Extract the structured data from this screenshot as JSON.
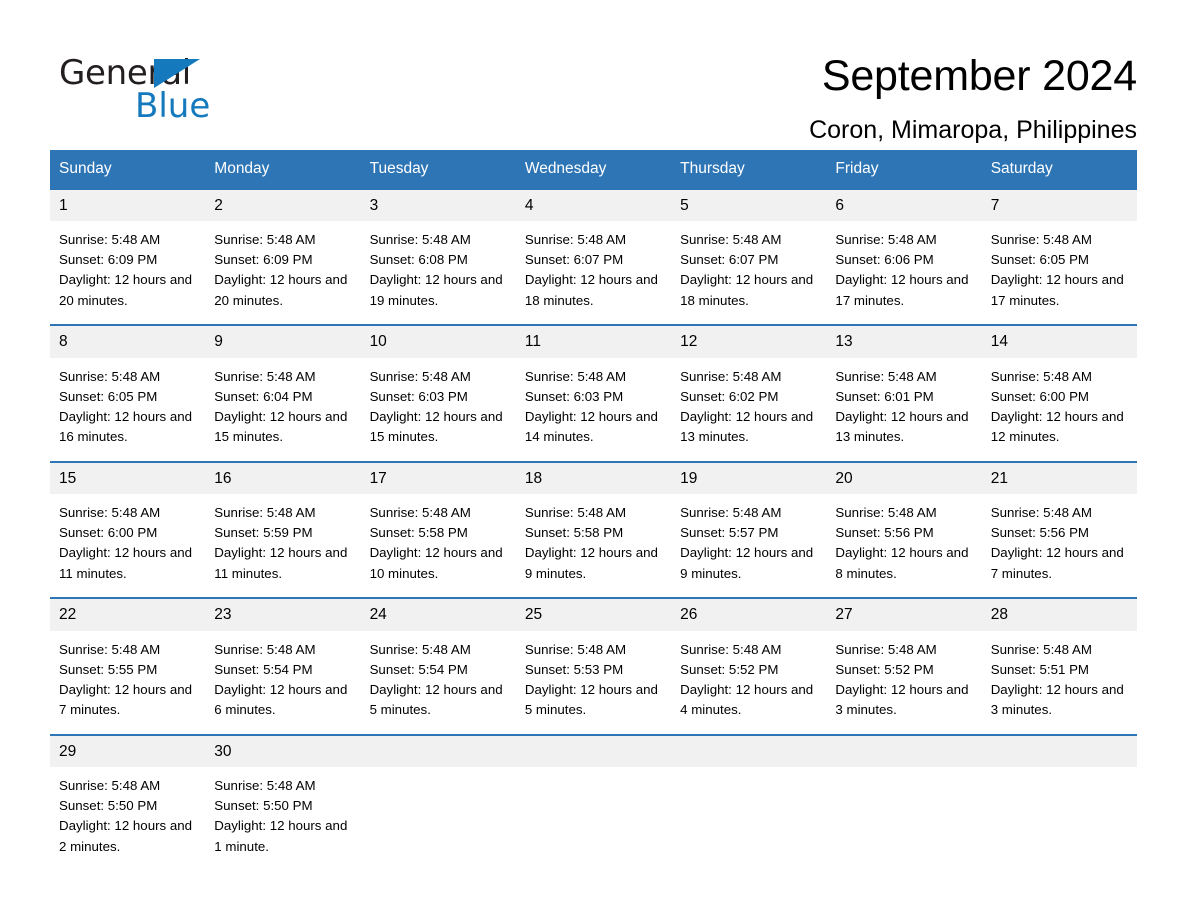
{
  "brand": {
    "name_part1": "General",
    "name_part2": "Blue",
    "accent_color": "#1479bd"
  },
  "header": {
    "title": "September 2024",
    "subtitle": "Coron, Mimaropa, Philippines"
  },
  "calendar": {
    "header_color": "#2E75B6",
    "daynum_band_color": "#F1F1F1",
    "weekdays": [
      "Sunday",
      "Monday",
      "Tuesday",
      "Wednesday",
      "Thursday",
      "Friday",
      "Saturday"
    ],
    "weeks": [
      {
        "days": [
          {
            "num": "1",
            "sunrise": "Sunrise: 5:48 AM",
            "sunset": "Sunset: 6:09 PM",
            "daylight": "Daylight: 12 hours and 20 minutes."
          },
          {
            "num": "2",
            "sunrise": "Sunrise: 5:48 AM",
            "sunset": "Sunset: 6:09 PM",
            "daylight": "Daylight: 12 hours and 20 minutes."
          },
          {
            "num": "3",
            "sunrise": "Sunrise: 5:48 AM",
            "sunset": "Sunset: 6:08 PM",
            "daylight": "Daylight: 12 hours and 19 minutes."
          },
          {
            "num": "4",
            "sunrise": "Sunrise: 5:48 AM",
            "sunset": "Sunset: 6:07 PM",
            "daylight": "Daylight: 12 hours and 18 minutes."
          },
          {
            "num": "5",
            "sunrise": "Sunrise: 5:48 AM",
            "sunset": "Sunset: 6:07 PM",
            "daylight": "Daylight: 12 hours and 18 minutes."
          },
          {
            "num": "6",
            "sunrise": "Sunrise: 5:48 AM",
            "sunset": "Sunset: 6:06 PM",
            "daylight": "Daylight: 12 hours and 17 minutes."
          },
          {
            "num": "7",
            "sunrise": "Sunrise: 5:48 AM",
            "sunset": "Sunset: 6:05 PM",
            "daylight": "Daylight: 12 hours and 17 minutes."
          }
        ]
      },
      {
        "days": [
          {
            "num": "8",
            "sunrise": "Sunrise: 5:48 AM",
            "sunset": "Sunset: 6:05 PM",
            "daylight": "Daylight: 12 hours and 16 minutes."
          },
          {
            "num": "9",
            "sunrise": "Sunrise: 5:48 AM",
            "sunset": "Sunset: 6:04 PM",
            "daylight": "Daylight: 12 hours and 15 minutes."
          },
          {
            "num": "10",
            "sunrise": "Sunrise: 5:48 AM",
            "sunset": "Sunset: 6:03 PM",
            "daylight": "Daylight: 12 hours and 15 minutes."
          },
          {
            "num": "11",
            "sunrise": "Sunrise: 5:48 AM",
            "sunset": "Sunset: 6:03 PM",
            "daylight": "Daylight: 12 hours and 14 minutes."
          },
          {
            "num": "12",
            "sunrise": "Sunrise: 5:48 AM",
            "sunset": "Sunset: 6:02 PM",
            "daylight": "Daylight: 12 hours and 13 minutes."
          },
          {
            "num": "13",
            "sunrise": "Sunrise: 5:48 AM",
            "sunset": "Sunset: 6:01 PM",
            "daylight": "Daylight: 12 hours and 13 minutes."
          },
          {
            "num": "14",
            "sunrise": "Sunrise: 5:48 AM",
            "sunset": "Sunset: 6:00 PM",
            "daylight": "Daylight: 12 hours and 12 minutes."
          }
        ]
      },
      {
        "days": [
          {
            "num": "15",
            "sunrise": "Sunrise: 5:48 AM",
            "sunset": "Sunset: 6:00 PM",
            "daylight": "Daylight: 12 hours and 11 minutes."
          },
          {
            "num": "16",
            "sunrise": "Sunrise: 5:48 AM",
            "sunset": "Sunset: 5:59 PM",
            "daylight": "Daylight: 12 hours and 11 minutes."
          },
          {
            "num": "17",
            "sunrise": "Sunrise: 5:48 AM",
            "sunset": "Sunset: 5:58 PM",
            "daylight": "Daylight: 12 hours and 10 minutes."
          },
          {
            "num": "18",
            "sunrise": "Sunrise: 5:48 AM",
            "sunset": "Sunset: 5:58 PM",
            "daylight": "Daylight: 12 hours and 9 minutes."
          },
          {
            "num": "19",
            "sunrise": "Sunrise: 5:48 AM",
            "sunset": "Sunset: 5:57 PM",
            "daylight": "Daylight: 12 hours and 9 minutes."
          },
          {
            "num": "20",
            "sunrise": "Sunrise: 5:48 AM",
            "sunset": "Sunset: 5:56 PM",
            "daylight": "Daylight: 12 hours and 8 minutes."
          },
          {
            "num": "21",
            "sunrise": "Sunrise: 5:48 AM",
            "sunset": "Sunset: 5:56 PM",
            "daylight": "Daylight: 12 hours and 7 minutes."
          }
        ]
      },
      {
        "days": [
          {
            "num": "22",
            "sunrise": "Sunrise: 5:48 AM",
            "sunset": "Sunset: 5:55 PM",
            "daylight": "Daylight: 12 hours and 7 minutes."
          },
          {
            "num": "23",
            "sunrise": "Sunrise: 5:48 AM",
            "sunset": "Sunset: 5:54 PM",
            "daylight": "Daylight: 12 hours and 6 minutes."
          },
          {
            "num": "24",
            "sunrise": "Sunrise: 5:48 AM",
            "sunset": "Sunset: 5:54 PM",
            "daylight": "Daylight: 12 hours and 5 minutes."
          },
          {
            "num": "25",
            "sunrise": "Sunrise: 5:48 AM",
            "sunset": "Sunset: 5:53 PM",
            "daylight": "Daylight: 12 hours and 5 minutes."
          },
          {
            "num": "26",
            "sunrise": "Sunrise: 5:48 AM",
            "sunset": "Sunset: 5:52 PM",
            "daylight": "Daylight: 12 hours and 4 minutes."
          },
          {
            "num": "27",
            "sunrise": "Sunrise: 5:48 AM",
            "sunset": "Sunset: 5:52 PM",
            "daylight": "Daylight: 12 hours and 3 minutes."
          },
          {
            "num": "28",
            "sunrise": "Sunrise: 5:48 AM",
            "sunset": "Sunset: 5:51 PM",
            "daylight": "Daylight: 12 hours and 3 minutes."
          }
        ]
      },
      {
        "days": [
          {
            "num": "29",
            "sunrise": "Sunrise: 5:48 AM",
            "sunset": "Sunset: 5:50 PM",
            "daylight": "Daylight: 12 hours and 2 minutes."
          },
          {
            "num": "30",
            "sunrise": "Sunrise: 5:48 AM",
            "sunset": "Sunset: 5:50 PM",
            "daylight": "Daylight: 12 hours and 1 minute."
          },
          {
            "num": "",
            "sunrise": "",
            "sunset": "",
            "daylight": ""
          },
          {
            "num": "",
            "sunrise": "",
            "sunset": "",
            "daylight": ""
          },
          {
            "num": "",
            "sunrise": "",
            "sunset": "",
            "daylight": ""
          },
          {
            "num": "",
            "sunrise": "",
            "sunset": "",
            "daylight": ""
          },
          {
            "num": "",
            "sunrise": "",
            "sunset": "",
            "daylight": ""
          }
        ]
      }
    ]
  }
}
